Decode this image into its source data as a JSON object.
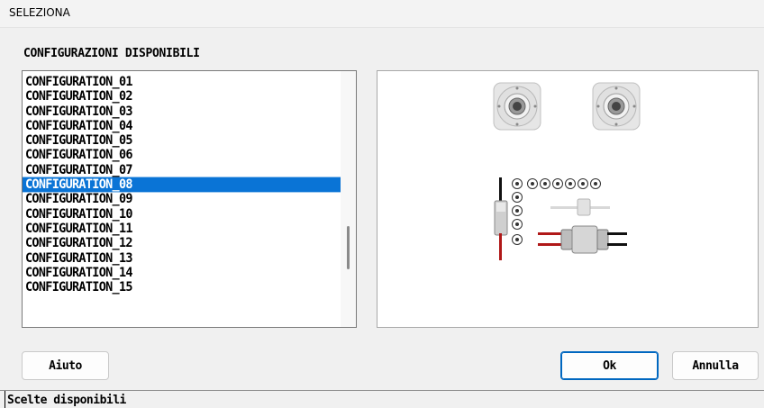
{
  "window": {
    "title": "SELEZIONA"
  },
  "group": {
    "label": "CONFIGURAZIONI DISPONIBILI"
  },
  "list": {
    "items": [
      "CONFIGURATION_01",
      "CONFIGURATION_02",
      "CONFIGURATION_03",
      "CONFIGURATION_04",
      "CONFIGURATION_05",
      "CONFIGURATION_06",
      "CONFIGURATION_07",
      "CONFIGURATION_08",
      "CONFIGURATION_09",
      "CONFIGURATION_10",
      "CONFIGURATION_11",
      "CONFIGURATION_12",
      "CONFIGURATION_13",
      "CONFIGURATION_14",
      "CONFIGURATION_15"
    ],
    "selected_index": 7
  },
  "buttons": {
    "help": "Aiuto",
    "ok": "Ok",
    "cancel": "Annulla"
  },
  "status": {
    "text": "Scelte disponibili"
  },
  "colors": {
    "selection": "#0a74d6",
    "cable_red": "#b01818",
    "cable_black": "#111111"
  }
}
